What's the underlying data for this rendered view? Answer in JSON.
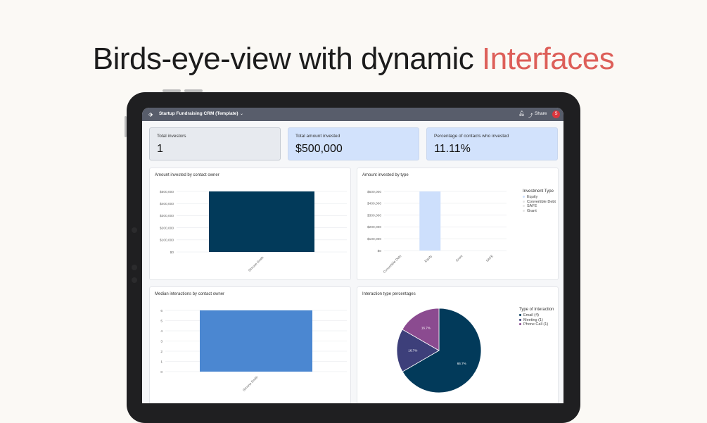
{
  "headline": {
    "main": "Birds-eye-view with dynamic ",
    "accent": "Interfaces"
  },
  "app": {
    "title": "Startup Fundraising CRM (Template)",
    "share_label": "Share",
    "avatar_initial": "S"
  },
  "kpis": [
    {
      "label": "Total investors",
      "value": "1"
    },
    {
      "label": "Total amount invested",
      "value": "$500,000"
    },
    {
      "label": "Percentage of contacts who invested",
      "value": "11.11%"
    }
  ],
  "colors": {
    "accent": "#dd5f59",
    "bar_dark": "#023a5a",
    "bar_light": "#cddffc",
    "bar_blue": "#4b87d1",
    "pie_email": "#023a5a",
    "pie_meeting": "#3d3f7a",
    "pie_phone": "#8b4b90"
  },
  "chart_data": [
    {
      "type": "bar",
      "title": "Amount invested by contact owner",
      "categories": [
        "Simone Smith"
      ],
      "values": [
        500000
      ],
      "ylim": [
        0,
        500000
      ],
      "yticks": [
        "$0",
        "$100,000",
        "$200,000",
        "$300,000",
        "$400,000",
        "$500,000"
      ],
      "grid": true
    },
    {
      "type": "bar",
      "title": "Amount invested by type",
      "categories": [
        "Convertible Debt",
        "Equity",
        "Grant",
        "SAFE"
      ],
      "values": [
        0,
        500000,
        0,
        0
      ],
      "ylim": [
        0,
        500000
      ],
      "yticks": [
        "$0",
        "$100,000",
        "$200,000",
        "$300,000",
        "$400,000",
        "$500,000"
      ],
      "legend_title": "Investment Type",
      "legend": [
        "Equity",
        "Convertible Debt",
        "SAFE",
        "Grant"
      ],
      "legend_position": "right",
      "grid": true
    },
    {
      "type": "bar",
      "title": "Median interactions by contact owner",
      "categories": [
        "Simone Smith"
      ],
      "values": [
        6
      ],
      "ylim": [
        0,
        6
      ],
      "yticks": [
        "0",
        "1",
        "2",
        "3",
        "4",
        "5",
        "6"
      ],
      "grid": true
    },
    {
      "type": "pie",
      "title": "Interaction type percentages",
      "legend_title": "Type of Interaction",
      "slices": [
        {
          "label": "Email (4)",
          "value": 66.7,
          "display": "66.7%"
        },
        {
          "label": "Meeting (1)",
          "value": 16.7,
          "display": "16.7%"
        },
        {
          "label": "Phone Call (1)",
          "value": 16.7,
          "display": "16.7%"
        }
      ],
      "legend_position": "right"
    }
  ]
}
